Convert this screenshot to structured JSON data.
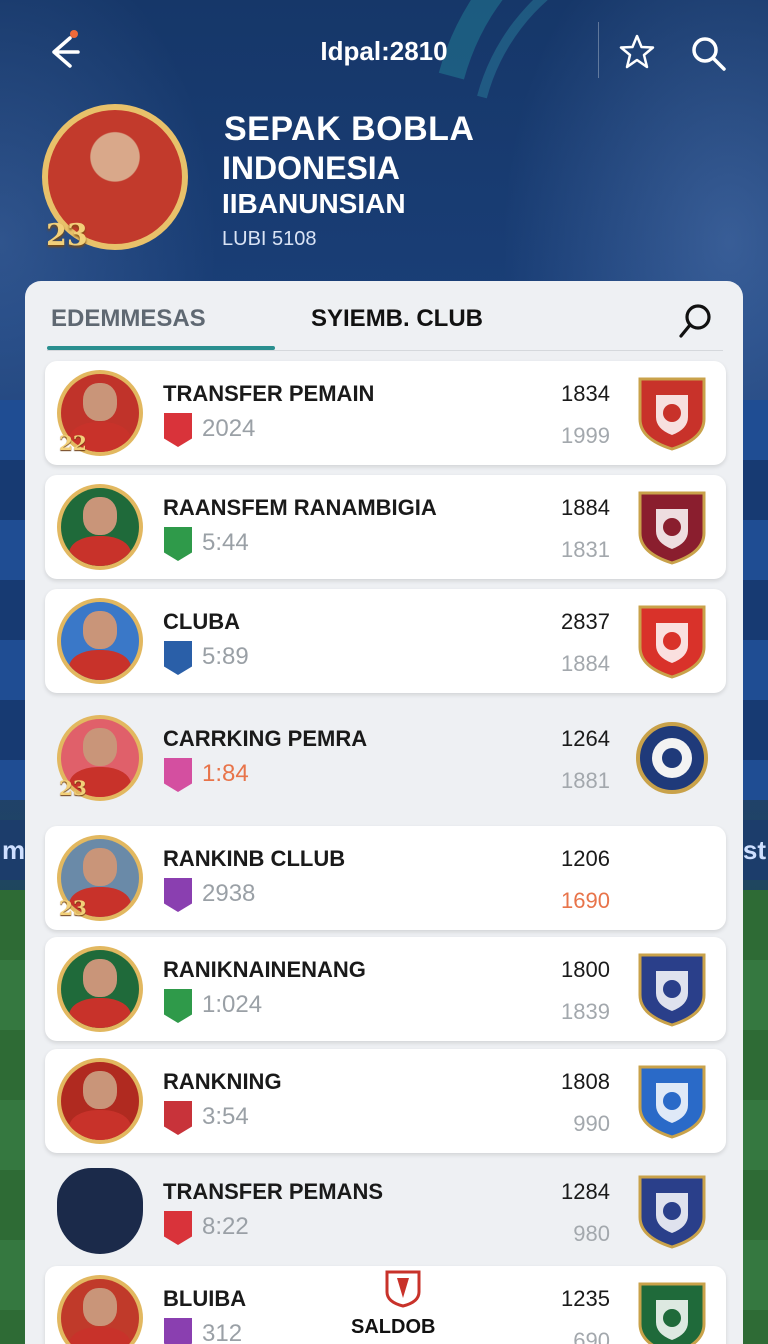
{
  "header": {
    "title": "Idpal:2810",
    "back_icon": "back-arrow-icon",
    "star_icon": "star-icon",
    "search_icon": "search-icon"
  },
  "profile": {
    "number": "23",
    "name_line1": "SEPAK BOBLA",
    "name_line2": "INDONESIA",
    "name_line3": "IIBANUNSIAN",
    "subtitle": "LUBI 5108"
  },
  "tabs": [
    {
      "label": "EDEMMESAS",
      "active": true
    },
    {
      "label": "SYIEMB. CLUB",
      "active": false
    }
  ],
  "rows": [
    {
      "title": "TRANSFER PEMAIN",
      "stat": "2024",
      "value1": "1834",
      "value2": "1999",
      "avatar_number": "22",
      "badge_color": "#d9333a",
      "avatar_bg": "#c0332a",
      "stat_color": "#9aa0a6",
      "value2_color": "#a3a8ad",
      "crest_color": "#c8322a"
    },
    {
      "title": "RAANSFEM RANAMBIGIA",
      "stat": "5:44",
      "value1": "1884",
      "value2": "1831",
      "avatar_number": "",
      "badge_color": "#2f9a4a",
      "avatar_bg": "#1f6a3a",
      "stat_color": "#9aa0a6",
      "value2_color": "#a3a8ad",
      "crest_color": "#8a1e2e"
    },
    {
      "title": "CLUBA",
      "stat": "5:89",
      "value1": "2837",
      "value2": "1884",
      "avatar_number": "",
      "badge_color": "#2a5fa8",
      "avatar_bg": "#3a78c8",
      "stat_color": "#9aa0a6",
      "value2_color": "#a3a8ad",
      "crest_color": "#d9322a"
    },
    {
      "title": "CARRKING PEMRA",
      "stat": "1:84",
      "value1": "1264",
      "value2": "1881",
      "avatar_number": "23",
      "badge_color": "#d44fa0",
      "avatar_bg": "#e0606a",
      "stat_color": "#e8744a",
      "value2_color": "#a3a8ad",
      "crest_color": "#1f3a7a"
    },
    {
      "title": "RANKINB CLLUB",
      "stat": "2938",
      "value1": "1206",
      "value2": "1690",
      "avatar_number": "23",
      "badge_color": "#8a3fb0",
      "avatar_bg": "#6a8aa8",
      "stat_color": "#9aa0a6",
      "value2_color": "#e8744a",
      "crest_color": ""
    },
    {
      "title": "RANIKNAINENANG",
      "stat": "1:024",
      "value1": "1800",
      "value2": "1839",
      "avatar_number": "",
      "badge_color": "#2f9a4a",
      "avatar_bg": "#1f6a3a",
      "stat_color": "#9aa0a6",
      "value2_color": "#a3a8ad",
      "crest_color": "#2a3f8a"
    },
    {
      "title": "RANKNING",
      "stat": "3:54",
      "value1": "1808",
      "value2": "990",
      "avatar_number": "",
      "badge_color": "#c8333a",
      "avatar_bg": "#b02a20",
      "stat_color": "#9aa0a6",
      "value2_color": "#a3a8ad",
      "crest_color": "#2a6ac8"
    },
    {
      "title": "TRANSFER PEMANS",
      "stat": "8:22",
      "value1": "1284",
      "value2": "980",
      "avatar_number": "",
      "badge_color": "#d9333a",
      "avatar_bg": "",
      "stat_color": "#9aa0a6",
      "value2_color": "#a3a8ad",
      "crest_color": "#2a3f8a"
    },
    {
      "title": "BLUIBA",
      "stat": "312",
      "value1": "1235",
      "value2": "690",
      "avatar_number": "",
      "badge_color": "#8a3fb0",
      "avatar_bg": "#c03a2a",
      "stat_color": "#9aa0a6",
      "value2_color": "#a3a8ad",
      "crest_color": "#1f6a3a",
      "extra_label": "SALDOB"
    }
  ]
}
